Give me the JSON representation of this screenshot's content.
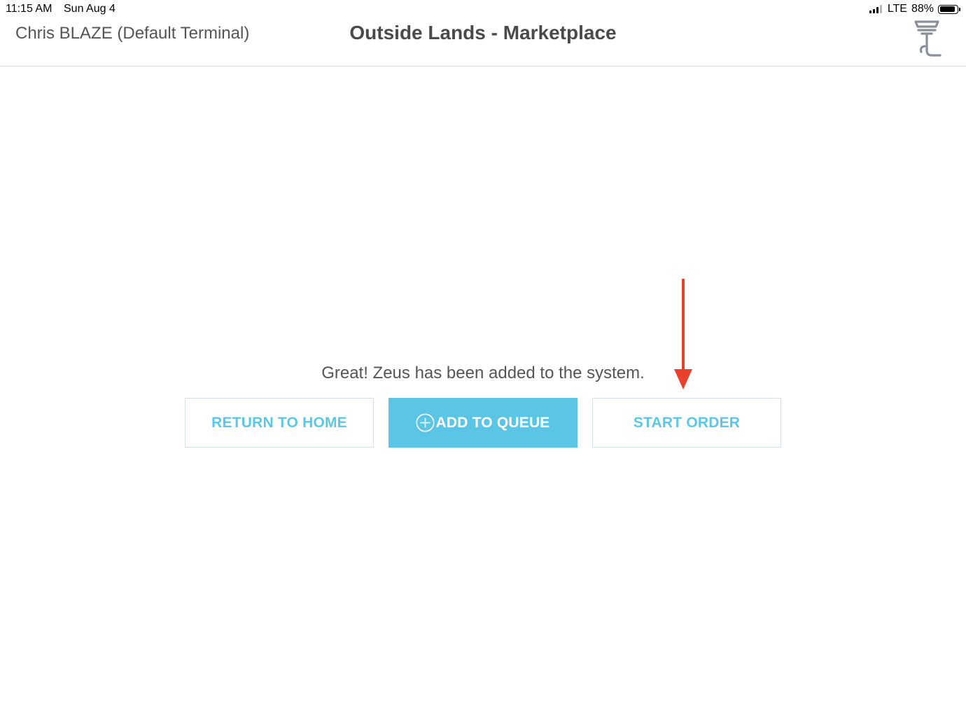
{
  "status_bar": {
    "time": "11:15 AM",
    "date": "Sun Aug 4",
    "network": "LTE",
    "battery": "88%",
    "battery_level": 0.88
  },
  "header": {
    "user_terminal": "Chris BLAZE (Default Terminal)",
    "title": "Outside Lands - Marketplace",
    "icon": "dabbing-rig-icon"
  },
  "main": {
    "message": "Great! Zeus has been added to the system.",
    "buttons": {
      "return_home": "RETURN TO HOME",
      "add_to_queue": "ADD TO QUEUE",
      "start_order": "START ORDER"
    }
  },
  "colors": {
    "accent": "#5bc5e5",
    "button_border": "#d7dfe7",
    "annotation": "#e8412c",
    "title_text": "#4a4a4a"
  }
}
